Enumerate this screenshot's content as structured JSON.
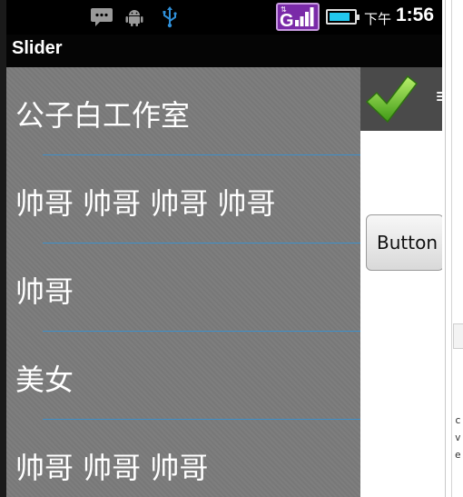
{
  "status_bar": {
    "ampm": "下午",
    "time": "1:56",
    "icons": [
      "message-icon",
      "android-debug-icon",
      "usb-icon",
      "signal-g-icon",
      "battery-icon"
    ],
    "signal_letter": "G",
    "battery_level": 0.85,
    "colors": {
      "signal_bg": "#7a2aa8",
      "battery": "#22c8ee"
    }
  },
  "title_bar": {
    "title": "Slider"
  },
  "slider": {
    "items": [
      {
        "label": "公子白工作室"
      },
      {
        "label": "帅哥 帅哥 帅哥 帅哥"
      },
      {
        "label": "帅哥"
      },
      {
        "label": "美女"
      },
      {
        "label": "帅哥 帅哥 帅哥"
      }
    ],
    "colors": {
      "background": "#7b7b7b",
      "divider": "#3e8fc9"
    }
  },
  "content": {
    "header_icon": "checkmark-icon",
    "header_text_peek": "≡",
    "button_label": "Button"
  },
  "ide_gutter": {
    "letters": [
      "c",
      "v",
      "e"
    ]
  }
}
